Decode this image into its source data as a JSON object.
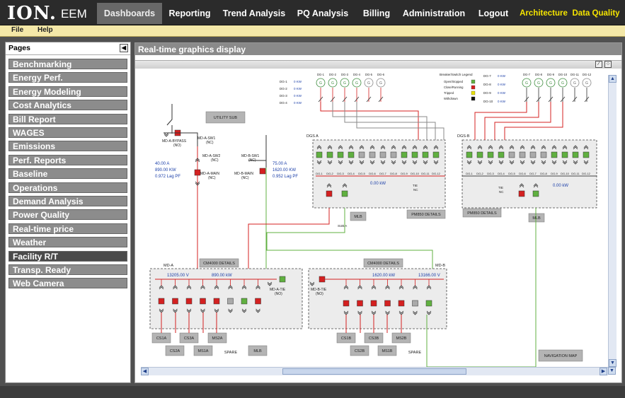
{
  "app": {
    "logo": "ION.",
    "product": "EEM"
  },
  "nav": {
    "dashboards": "Dashboards",
    "reporting": "Reporting",
    "trend": "Trend Analysis",
    "pq": "PQ Analysis",
    "billing": "Billing",
    "admin": "Administration",
    "logout": "Logout",
    "architecture": "Architecture",
    "data_quality": "Data Quality"
  },
  "menu": {
    "file": "File",
    "help": "Help"
  },
  "sidebar": {
    "title": "Pages",
    "items": [
      "Benchmarking",
      "Energy Perf.",
      "Energy Modeling",
      "Cost Analytics",
      "Bill Report",
      "WAGES",
      "Emissions",
      "Perf. Reports",
      "Baseline",
      "Operations",
      "Demand Analysis",
      "Power Quality",
      "Real-time price",
      "Weather",
      "Facility R/T",
      "Transp. Ready",
      "Web Camera"
    ]
  },
  "main": {
    "title": "Real-time graphics display"
  },
  "colors": {
    "energized": "#d42020",
    "de_energized": "#60b040",
    "tripped": "#e8e000",
    "withdrawn": "#111111",
    "gen_circle": "#3c8c3c"
  },
  "diagram": {
    "utility_sub": "UTILITY SUB",
    "bypass": {
      "name": "MD-A-BYPASS",
      "state": "(NO)"
    },
    "sw1a": {
      "name": "MD-A-SW1",
      "state": "(NC)"
    },
    "sw2a": {
      "name": "MD-A-SW2",
      "state": "(NC)"
    },
    "sw1b": {
      "name": "MD-B-SW1",
      "state": "(NC)"
    },
    "main_a": {
      "name": "MD-A-MAIN",
      "state": "(NC)"
    },
    "main_b": {
      "name": "MD-B-MAIN",
      "state": "(NC)"
    },
    "meter_a": {
      "current": "40.00 A",
      "power": "890.00 KW",
      "pf": "0.972 Lag PF"
    },
    "meter_b": {
      "current": "75.00 A",
      "power": "1620.00 KW",
      "pf": "0.952 Lag PF"
    },
    "gen_list_left": [
      {
        "name": "DG-1",
        "kw": "0 KW"
      },
      {
        "name": "DG-2",
        "kw": "0 KW"
      },
      {
        "name": "DG-3",
        "kw": "0 KW"
      },
      {
        "name": "DG-4",
        "kw": "0 KW"
      }
    ],
    "gen_list_right": [
      {
        "name": "DG-7",
        "kw": "0 KW"
      },
      {
        "name": "DG-8",
        "kw": "0 KW"
      },
      {
        "name": "DG-9",
        "kw": "0 KW"
      },
      {
        "name": "DG-10",
        "kw": "0 KW"
      }
    ],
    "gen_top_left": [
      "DG-1",
      "DG-2",
      "DG-3",
      "DG-4",
      "DG-5",
      "DG-6"
    ],
    "gen_top_right": [
      "DG-7",
      "DG-8",
      "DG-9",
      "DG-10",
      "DG-11",
      "DG-12"
    ],
    "gen_symbol": "G",
    "legend": {
      "title": "Breaker/Switch Legend",
      "items": [
        "Open/Stopped",
        "Close/Running",
        "Tripped",
        "Withdrawn"
      ]
    },
    "dgs_a": {
      "label": "DGS A",
      "feeders": [
        "DG-1",
        "DG-2",
        "DG-3",
        "DG-4",
        "DG-5",
        "DG-6",
        "DG-7",
        "DG-8",
        "DG-9",
        "DG-10",
        "DG-11",
        "DG-12"
      ],
      "kw": "0.00 kW",
      "tie": "TIE",
      "nc": "NC",
      "pm": "PM850 DETAILS",
      "sub": "SUB A",
      "mlb": "MLB"
    },
    "dgs_b": {
      "label": "DGS-B",
      "feeders": [
        "DG-1",
        "DG-2",
        "DG-3",
        "DG-4",
        "DG-5",
        "DG-6",
        "DG-7",
        "DG-8",
        "DG-9",
        "DG-10",
        "DG-11",
        "DG-12"
      ],
      "kw": "0.00 kW",
      "tie": "TIE",
      "nc": "NC",
      "pm": "PM850 DETAILS",
      "mlb": "MLB"
    },
    "md_a": {
      "label": "MD-A",
      "cm": "CM4000 DETAILS",
      "volts": "13205.00 V",
      "kw": "890.00 kW",
      "tie": "MD-A-TIE",
      "tie_state": "(NO)"
    },
    "md_b": {
      "label": "MD-B",
      "cm": "CM4000 DETAILS",
      "kw": "1620.00 kW",
      "volts": "13166.00 V",
      "tie": "MD-B-TIE",
      "tie_state": "(NO)"
    },
    "loads_a_row1": [
      "CS1A",
      "CS3A",
      "MS2A"
    ],
    "loads_a_row2": [
      "CS2A",
      "MS1A",
      "SPARE",
      "MLB"
    ],
    "loads_b_row1": [
      "CS1B",
      "CS3B",
      "MS2B"
    ],
    "loads_b_row2": [
      "CS2B",
      "MS1B",
      "SPARE"
    ],
    "nav_map": "NAVIGATION MAP"
  }
}
